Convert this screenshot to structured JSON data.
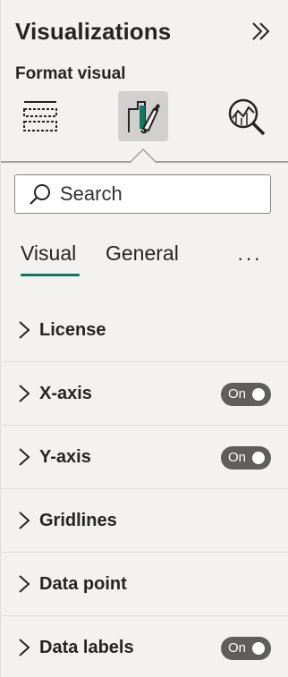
{
  "pane": {
    "title": "Visualizations",
    "subtitle": "Format visual",
    "collapse_icon": "double-chevron-right-icon"
  },
  "format_types": [
    {
      "name": "build-visual-icon",
      "active": false
    },
    {
      "name": "format-visual-icon",
      "active": true
    },
    {
      "name": "analytics-icon",
      "active": false
    }
  ],
  "search": {
    "placeholder": "Search",
    "value": ""
  },
  "tabs": {
    "visual": "Visual",
    "general": "General",
    "more": "···",
    "active": "Visual"
  },
  "cards": [
    {
      "label": "License",
      "toggle": null
    },
    {
      "label": "X-axis",
      "toggle": "On"
    },
    {
      "label": "Y-axis",
      "toggle": "On"
    },
    {
      "label": "Gridlines",
      "toggle": null
    },
    {
      "label": "Data point",
      "toggle": null
    },
    {
      "label": "Data labels",
      "toggle": "On"
    }
  ],
  "colors": {
    "accent": "#117865",
    "toggle_bg": "#5f5e5c",
    "pane_bg": "#f3f2f1"
  }
}
